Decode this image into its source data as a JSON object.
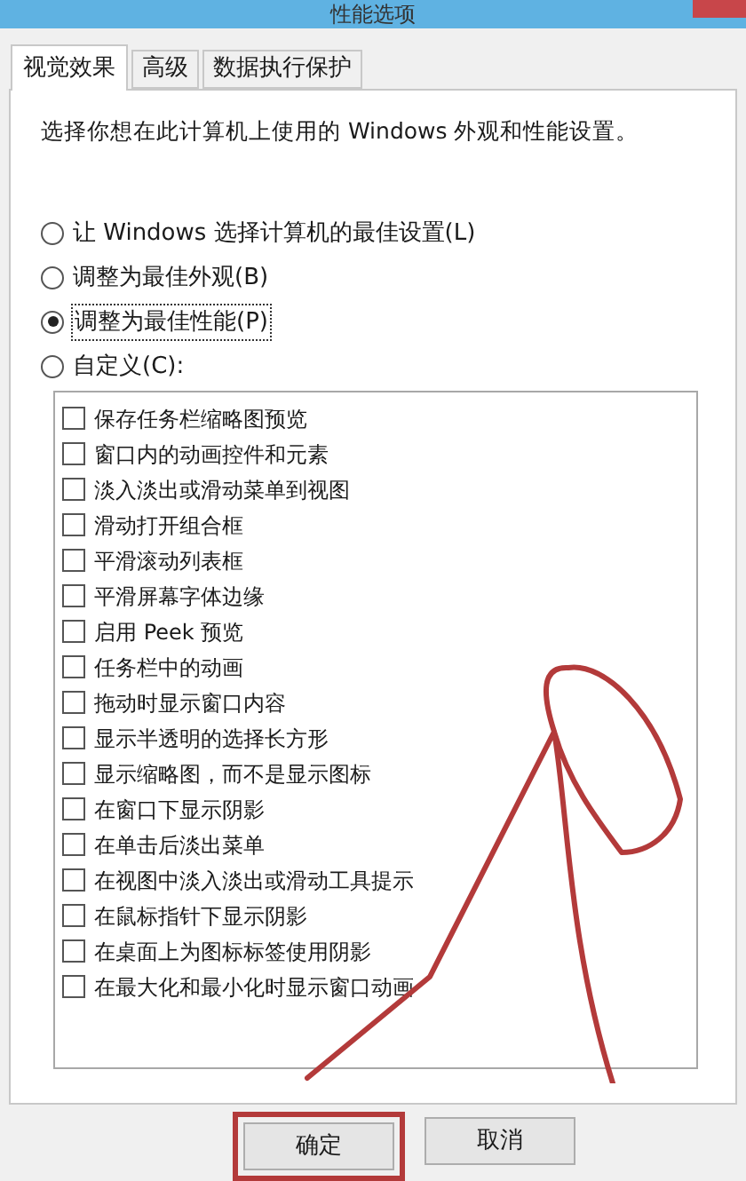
{
  "window": {
    "title": "性能选项"
  },
  "tabs": [
    {
      "label": "视觉效果",
      "selected": true
    },
    {
      "label": "高级",
      "selected": false
    },
    {
      "label": "数据执行保护",
      "selected": false
    }
  ],
  "description": "选择你想在此计算机上使用的 Windows 外观和性能设置。",
  "options": [
    {
      "label": "让 Windows 选择计算机的最佳设置(L)",
      "selected": false
    },
    {
      "label": "调整为最佳外观(B)",
      "selected": false
    },
    {
      "label": "调整为最佳性能(P)",
      "selected": true
    },
    {
      "label": "自定义(C):",
      "selected": false
    }
  ],
  "effects": [
    {
      "label": "保存任务栏缩略图预览",
      "checked": false
    },
    {
      "label": "窗口内的动画控件和元素",
      "checked": false
    },
    {
      "label": "淡入淡出或滑动菜单到视图",
      "checked": false
    },
    {
      "label": "滑动打开组合框",
      "checked": false
    },
    {
      "label": "平滑滚动列表框",
      "checked": false
    },
    {
      "label": "平滑屏幕字体边缘",
      "checked": false
    },
    {
      "label": "启用 Peek 预览",
      "checked": false
    },
    {
      "label": "任务栏中的动画",
      "checked": false
    },
    {
      "label": "拖动时显示窗口内容",
      "checked": false
    },
    {
      "label": "显示半透明的选择长方形",
      "checked": false
    },
    {
      "label": "显示缩略图，而不是显示图标",
      "checked": false
    },
    {
      "label": "在窗口下显示阴影",
      "checked": false
    },
    {
      "label": "在单击后淡出菜单",
      "checked": false
    },
    {
      "label": "在视图中淡入淡出或滑动工具提示",
      "checked": false
    },
    {
      "label": "在鼠标指针下显示阴影",
      "checked": false
    },
    {
      "label": "在桌面上为图标标签使用阴影",
      "checked": false
    },
    {
      "label": "在最大化和最小化时显示窗口动画",
      "checked": false
    }
  ],
  "buttons": [
    {
      "label": "确定",
      "highlighted": true
    },
    {
      "label": "取消",
      "highlighted": false
    }
  ]
}
